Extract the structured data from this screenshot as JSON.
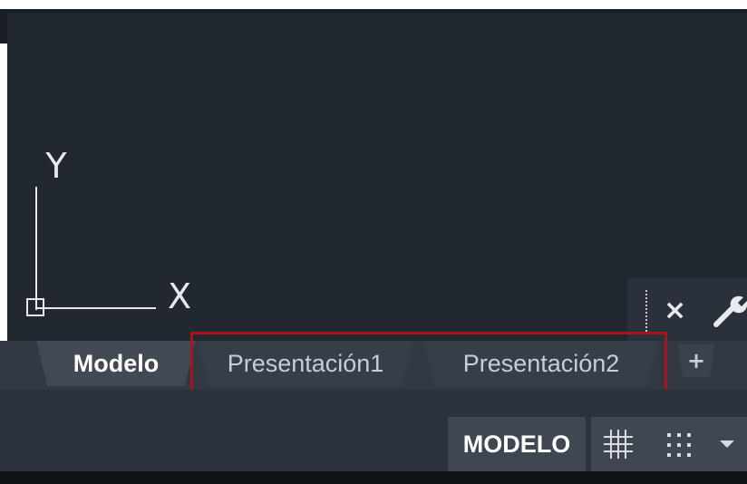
{
  "viewport": {
    "ucs": {
      "y_label": "Y",
      "x_label": "X"
    }
  },
  "command_line": {
    "close_icon": "×",
    "settings_icon_name": "wrench-icon"
  },
  "layout_tabs": {
    "items": [
      {
        "label": "Modelo",
        "active": true
      },
      {
        "label": "Presentación1",
        "active": false
      },
      {
        "label": "Presentación2",
        "active": false
      }
    ],
    "add_label": "+"
  },
  "status_bar": {
    "space_label": "MODELO",
    "grid_icon": "grid-icon",
    "snap_icon": "snap-icon",
    "menu_icon": "dropdown-icon"
  },
  "colors": {
    "canvas": "#212830",
    "tab_active": "#404954",
    "highlight": "#a8141a"
  }
}
